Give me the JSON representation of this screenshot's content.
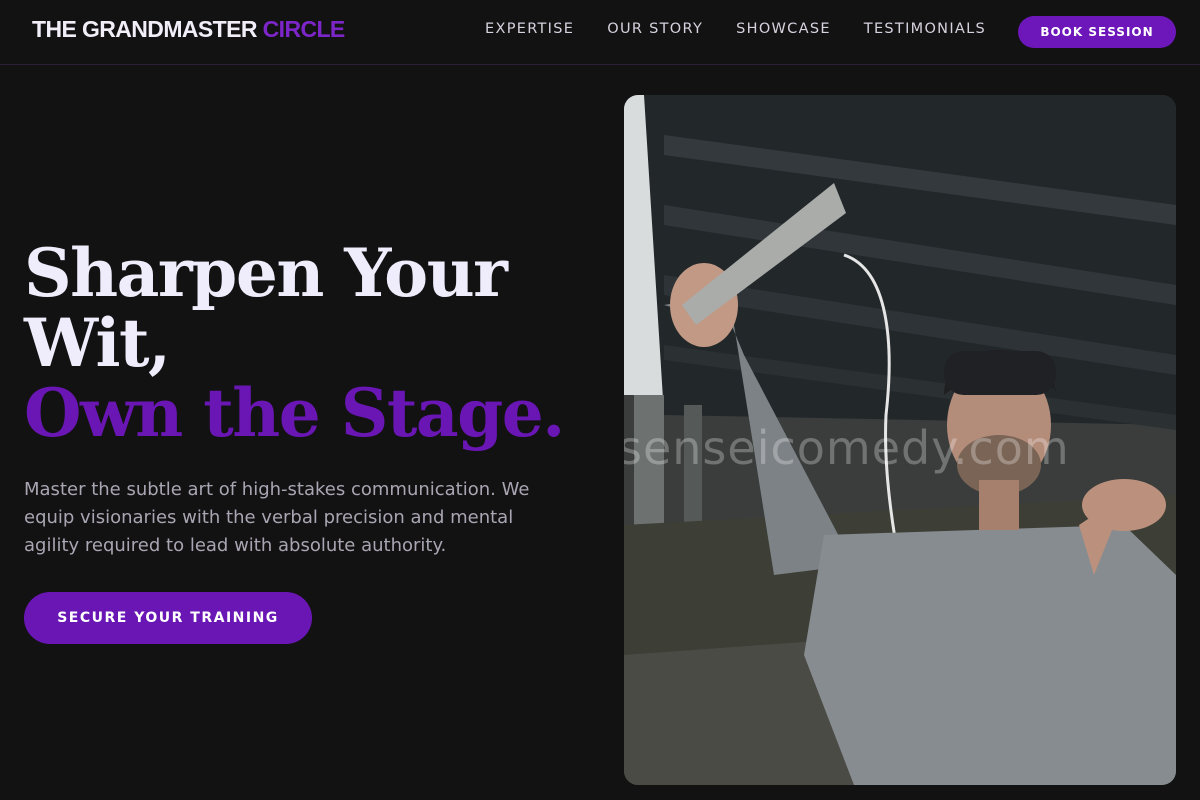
{
  "header": {
    "logo_main": "THE GRANDMASTER",
    "logo_accent": "CIRCLE",
    "nav": [
      "EXPERTISE",
      "OUR STORY",
      "SHOWCASE",
      "TESTIMONIALS"
    ],
    "book_label": "BOOK SESSION"
  },
  "hero": {
    "title_line1": "Sharpen Your",
    "title_line2": "Wit,",
    "title_accent": "Own the Stage.",
    "description": "Master the subtle art of high-stakes communication. We equip visionaries with the verbal precision and mental agility required to lead with absolute authority.",
    "cta_label": "SECURE YOUR TRAINING",
    "watermark": "senseicomedy.com"
  },
  "colors": {
    "background": "#131213",
    "accent": "#6a16b5",
    "title": "#efedfb",
    "body_text": "#a9a5b2"
  }
}
